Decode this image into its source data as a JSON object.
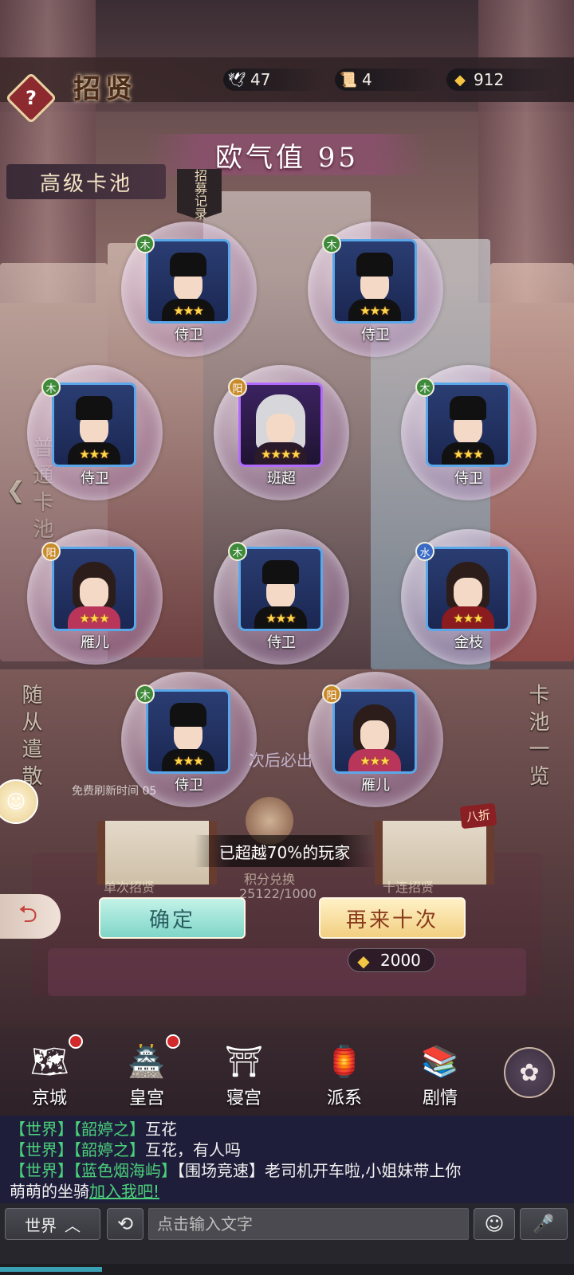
{
  "header": {
    "title": "招贤",
    "help_label": "?",
    "resources": [
      {
        "icon": "crane-icon",
        "value": "47"
      },
      {
        "icon": "scroll-icon",
        "value": "4"
      },
      {
        "icon": "gold-ingot-icon",
        "value": "912"
      }
    ]
  },
  "luck": {
    "label": "欧气值 95"
  },
  "pool": {
    "label": "高级卡池",
    "record_tag": "招募记录"
  },
  "side_texts": {
    "left_pool": "普通卡池",
    "left_dismiss": "随从遣散",
    "right_overview": "卡池一览"
  },
  "results": [
    {
      "name": "侍卫",
      "element": "木",
      "element_type": "wood",
      "stars": 3,
      "rarity": "blue",
      "portrait": "guard"
    },
    {
      "name": "侍卫",
      "element": "木",
      "element_type": "wood",
      "stars": 3,
      "rarity": "blue",
      "portrait": "guard"
    },
    {
      "name": "侍卫",
      "element": "木",
      "element_type": "wood",
      "stars": 3,
      "rarity": "blue",
      "portrait": "guard"
    },
    {
      "name": "班超",
      "element": "阳",
      "element_type": "yang",
      "stars": 4,
      "rarity": "purple",
      "portrait": "silver"
    },
    {
      "name": "侍卫",
      "element": "木",
      "element_type": "wood",
      "stars": 3,
      "rarity": "blue",
      "portrait": "guard"
    },
    {
      "name": "雁儿",
      "element": "阳",
      "element_type": "yang",
      "stars": 3,
      "rarity": "blue",
      "portrait": "girl"
    },
    {
      "name": "侍卫",
      "element": "木",
      "element_type": "wood",
      "stars": 3,
      "rarity": "blue",
      "portrait": "guard"
    },
    {
      "name": "金枝",
      "element": "水",
      "element_type": "water",
      "stars": 3,
      "rarity": "blue",
      "portrait": "lady"
    },
    {
      "name": "侍卫",
      "element": "木",
      "element_type": "wood",
      "stars": 3,
      "rarity": "blue",
      "portrait": "guard"
    },
    {
      "name": "雁儿",
      "element": "阳",
      "element_type": "yang",
      "stars": 3,
      "rarity": "blue",
      "portrait": "girl"
    }
  ],
  "overlay": {
    "refresh_text": "免费刷新时间",
    "refresh_time": "05",
    "guarantee_text": "次后必出",
    "exceed_text": "已超越70%的玩家",
    "single_recruit": "单次招贤",
    "points_exchange": "积分兑换",
    "points_value": "25122/1000",
    "ten_recruit": "十连招贤",
    "discount": "八折"
  },
  "buttons": {
    "confirm": "确定",
    "again": "再来十次",
    "cost": "2000"
  },
  "nav": [
    {
      "label": "京城",
      "icon": "map-icon",
      "dot": true
    },
    {
      "label": "皇宫",
      "icon": "palace-icon",
      "dot": true
    },
    {
      "label": "寝宫",
      "icon": "bedchamber-icon",
      "dot": false
    },
    {
      "label": "派系",
      "icon": "faction-icon",
      "dot": false
    },
    {
      "label": "剧情",
      "icon": "book-icon",
      "dot": false
    }
  ],
  "chat": {
    "lines": [
      {
        "channel": "【世界】",
        "name": "【韶婷之】",
        "text": "互花"
      },
      {
        "channel": "【世界】",
        "name": "【韶婷之】",
        "text": "互花，有人吗"
      },
      {
        "channel": "【世界】",
        "name": "【蓝色烟海屿】",
        "text": "【围场竞速】老司机开车啦,小姐妹带上你"
      }
    ],
    "continuation": "萌萌的坐骑",
    "join_link": "加入我吧!",
    "channel_button": "世界",
    "input_placeholder": "点击输入文字"
  }
}
